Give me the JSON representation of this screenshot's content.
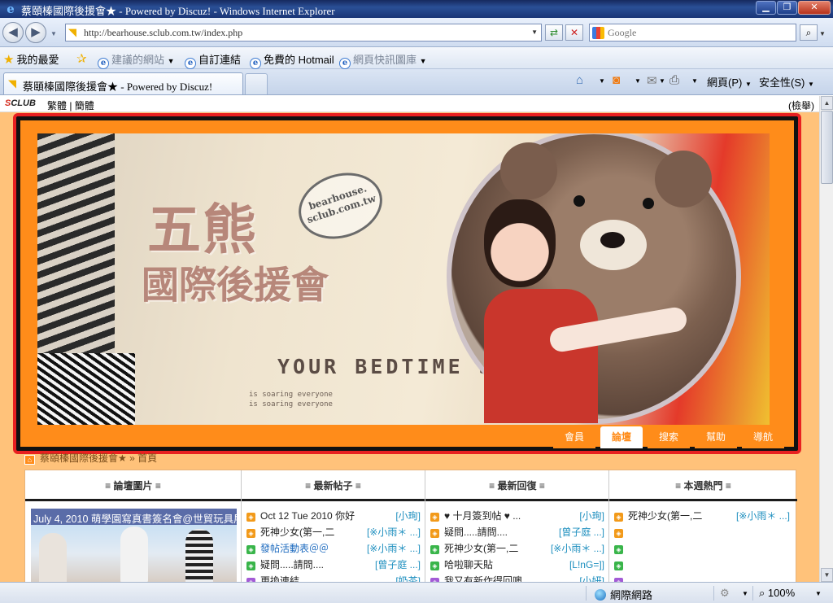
{
  "window": {
    "title": "蔡頤榛國際後援會★ - Powered by Discuz! - Windows Internet Explorer",
    "min_icon": "minimize-icon",
    "max_icon": "maximize-icon",
    "close_icon": "close-icon"
  },
  "address": {
    "url": "http://bearhouse.sclub.com.tw/index.php",
    "search_placeholder": "Google"
  },
  "favorites": {
    "title": "我的最愛",
    "items": [
      {
        "label": "建議的網站",
        "dim": true,
        "dropdown": true
      },
      {
        "label": "自訂連結"
      },
      {
        "label": "免費的 Hotmail"
      },
      {
        "label": "網頁快訊圖庫",
        "dim": true,
        "dropdown": true
      }
    ]
  },
  "tab": {
    "label": "蔡頤榛國際後援會★ - Powered by Discuz!"
  },
  "commands": {
    "page": "網頁(P)",
    "safety": "安全性(S)"
  },
  "sclub": {
    "logo_prefix": "S",
    "logo_rest": "CLUB",
    "lang": "繁體 | 簡體",
    "search": "(檢舉)"
  },
  "banner": {
    "logo_main": "五熊",
    "logo_sub": "國際後援會",
    "bubble_line1": "bearhouse.",
    "bubble_line2": "sclub.com.tw",
    "slogan": "YOUR BEDTIME S",
    "small_text": "is soaring everyone\nis soaring everyone"
  },
  "nav": {
    "tabs": [
      {
        "label": "會員",
        "active": false
      },
      {
        "label": "論壇",
        "active": true
      },
      {
        "label": "搜索",
        "active": false
      },
      {
        "label": "幫助",
        "active": false
      },
      {
        "label": "導航",
        "active": false
      }
    ]
  },
  "breadcrumb": {
    "site": "蔡頤榛國際後援會★",
    "sep": "»",
    "current": "首頁"
  },
  "board": {
    "columns": [
      {
        "title": "≡ 論壇圖片 ≡"
      },
      {
        "title": "≡ 最新帖子 ≡"
      },
      {
        "title": "≡ 最新回復 ≡"
      },
      {
        "title": "≡ 本週熱門 ≡"
      }
    ],
    "image_caption": "July 4, 2010 萌學園寫真書簽名會@世貿玩具展",
    "latest_posts": [
      {
        "title": "Oct 12 Tue 2010 你好",
        "author": "[小珣]",
        "badge": "orange",
        "link": false
      },
      {
        "title": "死神少女(第一,二",
        "author": "[※小雨＊ ...]",
        "badge": "orange",
        "link": false
      },
      {
        "title": "發帖活動表＠＠",
        "author": "[※小雨＊ ...]",
        "badge": "green",
        "link": true
      },
      {
        "title": "疑問.....請問....",
        "author": "[曾子庭 ...]",
        "badge": "green",
        "link": false
      },
      {
        "title": "更換連結",
        "author": "[奶茶]",
        "badge": "purple",
        "link": false
      }
    ],
    "latest_replies": [
      {
        "title": "♥ 十月簽到帖 ♥ ...",
        "author": "[小珣]",
        "badge": "orange"
      },
      {
        "title": "疑問.....請問....",
        "author": "[曾子庭 ...]",
        "badge": "orange"
      },
      {
        "title": "死神少女(第一,二",
        "author": "[※小雨＊ ...]",
        "badge": "green"
      },
      {
        "title": "哈啦聊天貼",
        "author": "[L!nG=]]",
        "badge": "green"
      },
      {
        "title": "我又有新作得回噢",
        "author": "[小妍]",
        "badge": "purple"
      }
    ],
    "weekly_hot": [
      {
        "title": "死神少女(第一,二",
        "author": "[※小雨＊ ...]",
        "badge": "orange"
      },
      {
        "title": "",
        "author": "",
        "badge": "orange"
      },
      {
        "title": "",
        "author": "",
        "badge": "green"
      },
      {
        "title": "",
        "author": "",
        "badge": "green"
      },
      {
        "title": "",
        "author": "",
        "badge": "purple"
      }
    ]
  },
  "status": {
    "zone": "網際網路",
    "zoom": "100%"
  }
}
